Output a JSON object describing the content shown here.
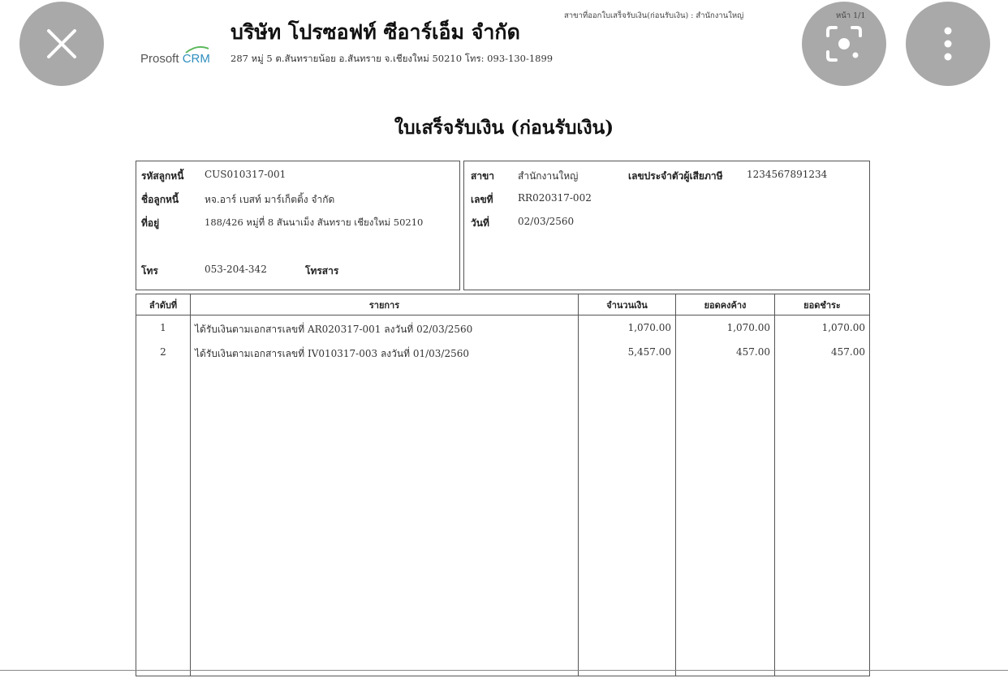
{
  "overlay": {
    "close_icon": "close-icon",
    "lens_icon": "lens-search-icon",
    "more_icon": "more-vertical-icon"
  },
  "header": {
    "company_name": "บริษัท โปรซอฟท์ ซีอาร์เอ็ม จำกัด",
    "logo_prefix": "Prosoft",
    "logo_suffix": "CRM",
    "address": "287 หมู่ 5 ต.สันทรายน้อย อ.สันทราย จ.เชียงใหม่ 50210 โทร: 093-130-1899",
    "branch_issued": "สาขาที่ออกใบเสร็จรับเงิน(ก่อนรับเงิน) : สำนักงานใหญ่",
    "page": "หน้า 1/1"
  },
  "document": {
    "title": "ใบเสร็จรับเงิน (ก่อนรับเงิน)"
  },
  "customer": {
    "code_label": "รหัสลูกหนี้",
    "code": "CUS010317-001",
    "name_label": "ชื่อลูกหนี้",
    "name": "หจ.อาร์ เบสท์ มาร์เก็ตติ้ง จำกัด",
    "address_label": "ที่อยู่",
    "address": "188/426 หมู่ที่ 8 สันนาเม็ง สันทราย เชียงใหม่ 50210",
    "phone_label": "โทร",
    "phone": "053-204-342",
    "fax_label": "โทรสาร",
    "fax": ""
  },
  "receipt": {
    "branch_label": "สาขา",
    "branch": "สำนักงานใหญ่",
    "tax_id_label": "เลขประจำตัวผู้เสียภาษี",
    "tax_id": "1234567891234",
    "number_label": "เลขที่",
    "number": "RR020317-002",
    "date_label": "วันที่",
    "date": "02/03/2560"
  },
  "table": {
    "headers": [
      "ลำดับที่",
      "รายการ",
      "จำนวนเงิน",
      "ยอดคงค้าง",
      "ยอดชำระ"
    ],
    "rows": [
      {
        "no": "1",
        "item": "ได้รับเงินตามเอกสารเลขที่ AR020317-001 ลงวันที่ 02/03/2560",
        "amount": "1,070.00",
        "outstanding": "1,070.00",
        "paid": "1,070.00"
      },
      {
        "no": "2",
        "item": "ได้รับเงินตามเอกสารเลขที่ IV010317-003 ลงวันที่ 01/03/2560",
        "amount": "5,457.00",
        "outstanding": "457.00",
        "paid": "457.00"
      }
    ]
  }
}
